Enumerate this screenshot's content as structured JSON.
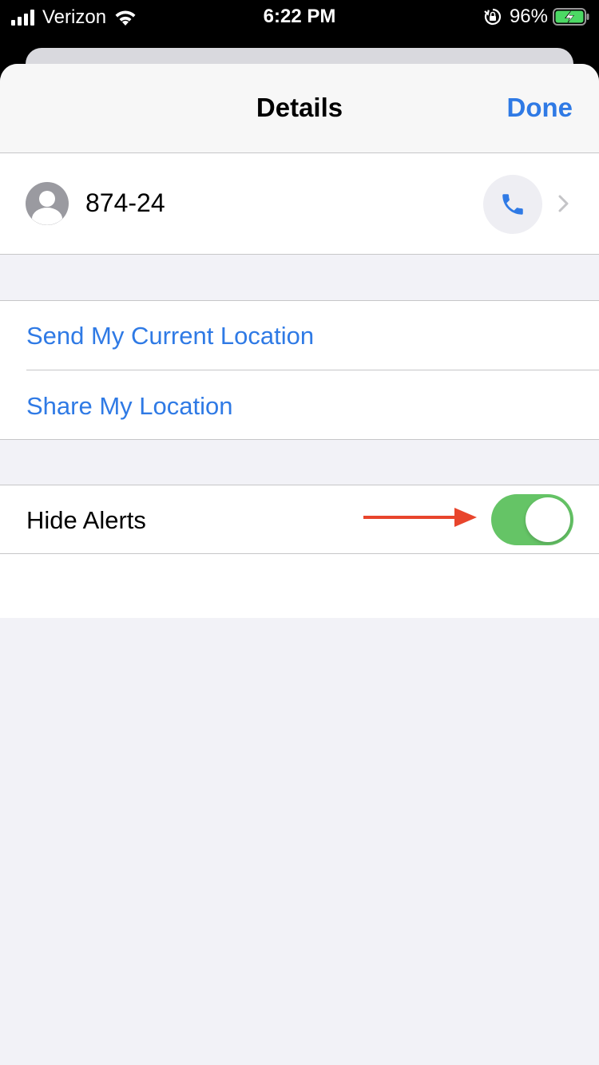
{
  "status_bar": {
    "carrier": "Verizon",
    "time": "6:22 PM",
    "battery_percent": "96%",
    "icons": [
      "signal-icon",
      "wifi-icon",
      "rotation-lock-icon",
      "battery-charging-icon"
    ]
  },
  "nav": {
    "title": "Details",
    "done_label": "Done"
  },
  "contact": {
    "name": "874-24",
    "icons": [
      "avatar-icon",
      "phone-icon",
      "chevron-right-icon"
    ]
  },
  "location": {
    "items": [
      {
        "label": "Send My Current Location"
      },
      {
        "label": "Share My Location"
      }
    ]
  },
  "alerts": {
    "label": "Hide Alerts",
    "toggle_on": true
  },
  "colors": {
    "accent": "#2f7ae5",
    "toggle_on": "#65c466",
    "annotation_arrow": "#e8452c",
    "background": "#f2f2f7"
  }
}
